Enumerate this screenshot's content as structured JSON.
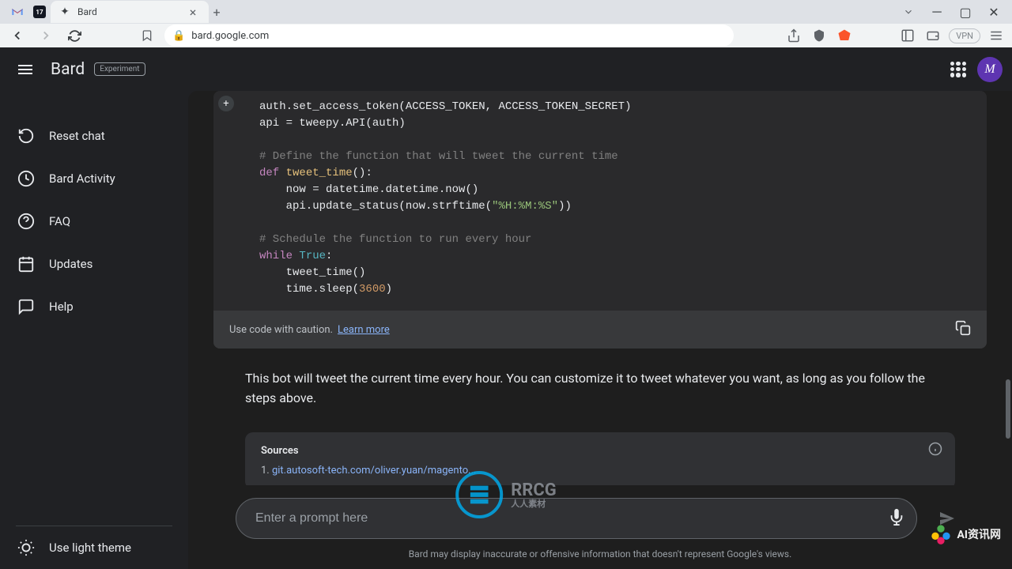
{
  "browser": {
    "tab_title": "Bard",
    "url": "bard.google.com",
    "vpn_label": "VPN"
  },
  "header": {
    "logo": "Bard",
    "badge": "Experiment",
    "avatar_initial": "M"
  },
  "sidebar": {
    "items": [
      {
        "label": "Reset chat",
        "icon": "refresh"
      },
      {
        "label": "Bard Activity",
        "icon": "history"
      },
      {
        "label": "FAQ",
        "icon": "help-circle"
      },
      {
        "label": "Updates",
        "icon": "calendar"
      },
      {
        "label": "Help",
        "icon": "message"
      }
    ],
    "theme_toggle": "Use light theme"
  },
  "content": {
    "code_lines": [
      {
        "text": "auth.set_access_token(ACCESS_TOKEN, ACCESS_TOKEN_SECRET)"
      },
      {
        "text": "api = tweepy.API(auth)"
      },
      {
        "text": ""
      },
      {
        "text": "# Define the function that will tweet the current time",
        "type": "comment"
      },
      {
        "text": "def tweet_time():",
        "type": "def"
      },
      {
        "text": "    now = datetime.datetime.now()"
      },
      {
        "text": "    api.update_status(now.strftime(\"%H:%M:%S\"))",
        "type": "str"
      },
      {
        "text": ""
      },
      {
        "text": "# Schedule the function to run every hour",
        "type": "comment"
      },
      {
        "text": "while True:",
        "type": "while"
      },
      {
        "text": "    tweet_time()"
      },
      {
        "text": "    time.sleep(3600)",
        "type": "num"
      }
    ],
    "caution_text": "Use code with caution.",
    "learn_more": "Learn more",
    "explanation": "This bot will tweet the current time every hour. You can customize it to tweet whatever you want, as long as you follow the steps above.",
    "sources_title": "Sources",
    "sources": [
      {
        "num": "1.",
        "url": "git.autosoft-tech.com/oliver.yuan/magento..."
      }
    ]
  },
  "input": {
    "placeholder": "Enter a prompt here",
    "disclaimer": "Bard may display inaccurate or offensive information that doesn't represent Google's views."
  },
  "watermark": {
    "center_main": "RRCG",
    "center_sub": "人人素材",
    "right": "AI资讯网"
  }
}
